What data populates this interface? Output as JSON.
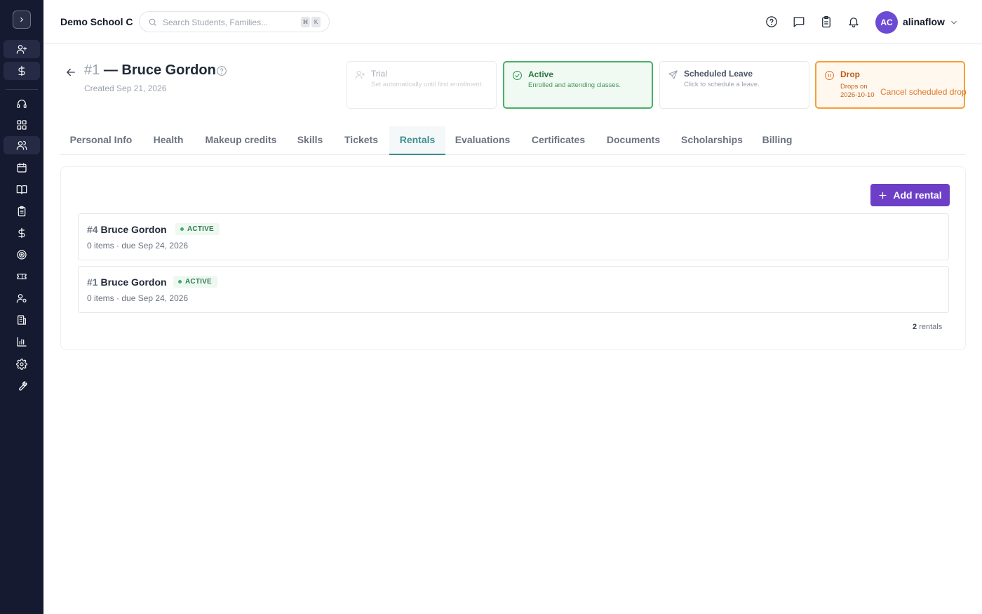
{
  "app": {
    "school_name": "Demo School C"
  },
  "search": {
    "placeholder": "Search Students, Families...",
    "shortcut_keys": [
      "⌘",
      "K"
    ]
  },
  "header": {
    "icons": [
      "help-circle-icon",
      "message-icon",
      "clipboard-icon",
      "bell-icon"
    ],
    "user": {
      "initials": "AC",
      "name": "alinaflow",
      "avatar_color": "#6d4ad4"
    }
  },
  "sidebar": {
    "items": [
      "add-user-icon",
      "dollar-icon",
      "headset-icon",
      "dashboard-icon",
      "users-icon",
      "calendar-icon",
      "book-icon",
      "clipboard-icon",
      "dollar-icon",
      "target-icon",
      "ticket-icon",
      "user-settings-icon",
      "building-icon",
      "bar-chart-icon",
      "gear-icon",
      "wrench-icon"
    ],
    "active_item": "users-icon"
  },
  "student": {
    "number": "#1",
    "separator": "—",
    "name": "Bruce Gordon",
    "created": "Created Sep 21, 2026"
  },
  "status_cards": {
    "trial": {
      "title": "Trial",
      "description": "Set automatically until first enrollment."
    },
    "active": {
      "title": "Active",
      "description": "Enrolled and attending classes."
    },
    "leave": {
      "title": "Scheduled Leave",
      "description": "Click to schedule a leave."
    },
    "drop": {
      "title": "Drop",
      "description": "Drops on 2026-10-10",
      "action": "Cancel scheduled drop"
    }
  },
  "tabs": [
    {
      "label": "Personal Info"
    },
    {
      "label": "Health"
    },
    {
      "label": "Makeup credits"
    },
    {
      "label": "Skills"
    },
    {
      "label": "Tickets"
    },
    {
      "label": "Rentals"
    },
    {
      "label": "Evaluations"
    },
    {
      "label": "Certificates"
    },
    {
      "label": "Documents"
    },
    {
      "label": "Scholarships"
    },
    {
      "label": "Billing"
    }
  ],
  "active_tab": "Rentals",
  "rentals": {
    "add_label": "Add rental",
    "items": [
      {
        "number": "#4",
        "name": "Bruce Gordon",
        "status": "ACTIVE",
        "detail": "0 items · due Sep 24, 2026"
      },
      {
        "number": "#1",
        "name": "Bruce Gordon",
        "status": "ACTIVE",
        "detail": "0 items · due Sep 24, 2026"
      }
    ],
    "count": "2",
    "count_label": "rentals"
  },
  "colors": {
    "sidebar_bg": "#161a30",
    "accent_purple": "#6d3fc7",
    "active_green": "#4caf68",
    "drop_orange": "#f59e3b",
    "tab_active": "#3f8f8f"
  }
}
